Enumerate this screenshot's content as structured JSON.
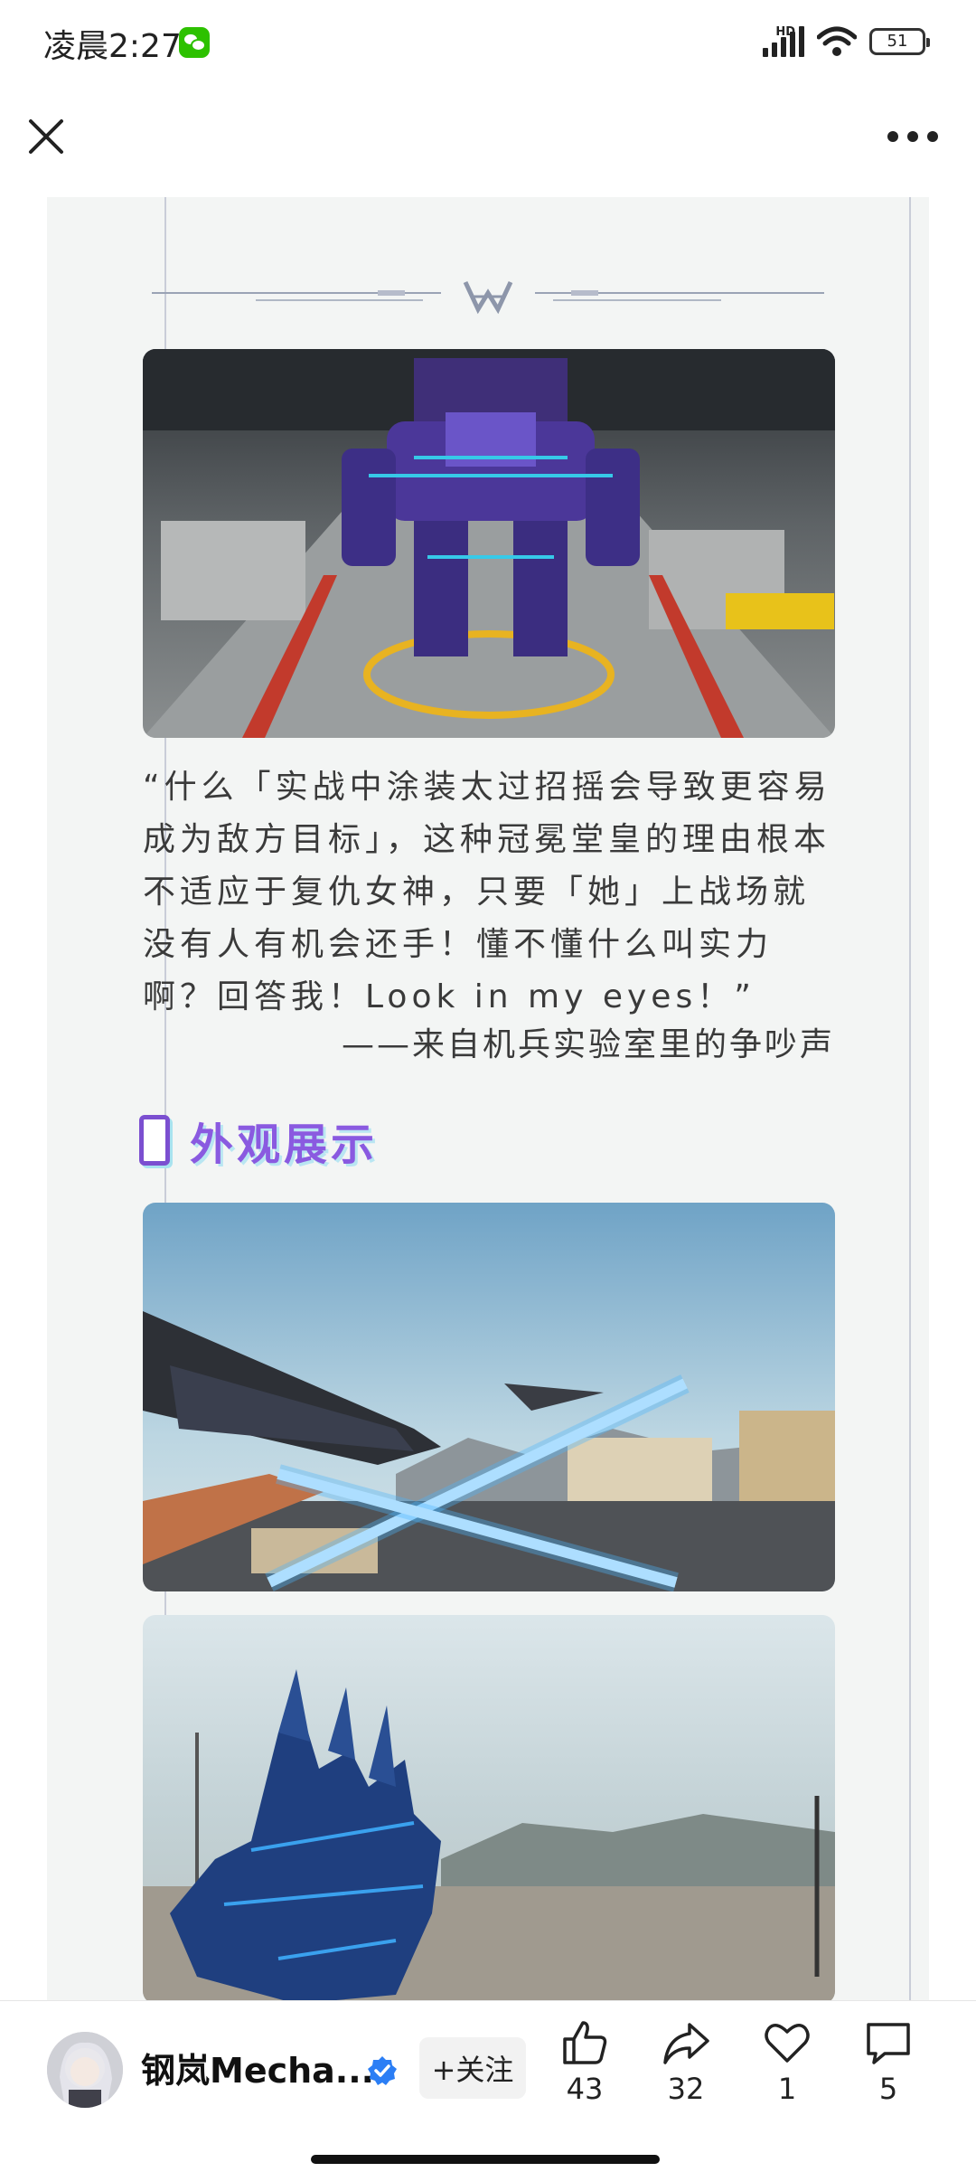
{
  "status_bar": {
    "time": "凌晨2:27",
    "network": "HD",
    "battery": "51"
  },
  "nav": {
    "close_icon": "close-icon",
    "more_icon": "more-icon"
  },
  "article": {
    "quote": "“什么「实战中涂装太过招摇会导致更容易成为敌方目标」，这种冠冕堂皇的理由根本不适应于复仇女神，只要「她」上战场就没有人有机会还手！懂不懂什么叫实力啊？回答我！Look in my eyes！”",
    "attribution": "——来自机兵实验室里的争吵声",
    "section_title": "外观展示"
  },
  "bottom": {
    "author": "钢岚Mecha...",
    "follow_label": "+关注",
    "like_count": "43",
    "share_count": "32",
    "favorite_count": "1",
    "comment_count": "5"
  },
  "colors": {
    "accent": "#8a5ae0",
    "wechat": "#2dc100",
    "verified": "#2b7ef5"
  }
}
